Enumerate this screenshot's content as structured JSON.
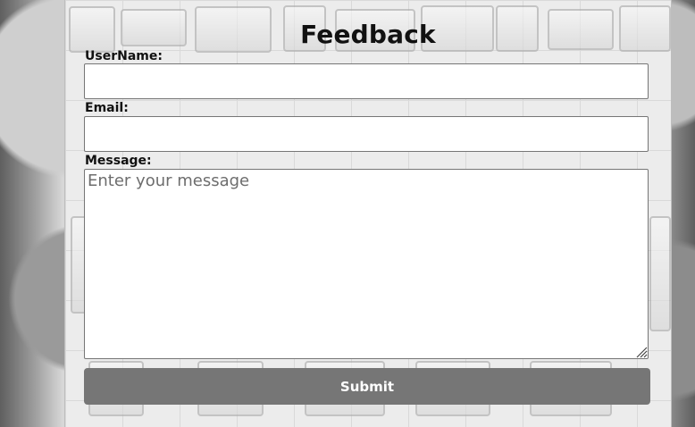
{
  "form": {
    "title": "Feedback",
    "username_label": "UserName:",
    "username_value": "",
    "email_label": "Email:",
    "email_value": "",
    "message_label": "Message:",
    "message_placeholder": "Enter your message",
    "submit_label": "Submit"
  },
  "colors": {
    "button": "#767676",
    "button_text": "#ffffff",
    "field_border": "#767676"
  }
}
